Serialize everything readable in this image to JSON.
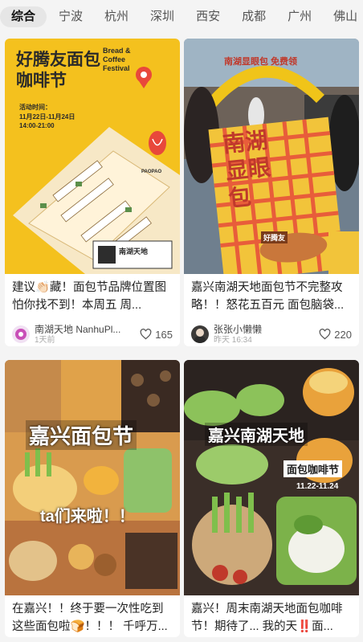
{
  "tabs": [
    "综合",
    "宁波",
    "杭州",
    "深圳",
    "西安",
    "成都",
    "广州",
    "佛山"
  ],
  "cards": [
    {
      "title": "建议👏🏻藏！面包节品牌位置图 怕你找不到！本周五 周...",
      "author": "南湖天地 NanhuPl...",
      "time": "1天前",
      "likes": "165",
      "image": {
        "heading": "好腾友面包咖啡节",
        "subheading": "Bread & Coffee Festival",
        "date_label": "活动时间：",
        "dates": "11月22日-11月24日",
        "hours": "14:00-21:00",
        "brand": "PAOPAO",
        "logo": "南湖天地"
      }
    },
    {
      "title": "嘉兴南湖天地面包节不完整攻略！！怒花五百元 面包脑袋...",
      "author": "张张小懒懒",
      "time": "昨天 16:34",
      "likes": "220",
      "image": {
        "banner": "南湖显眼包 免费领",
        "sign": "南湖显眼包",
        "tag": "好腾友"
      }
    },
    {
      "title": "在嘉兴！！终于要一次性吃到这些面包啦🍞！！！ 千呼万...",
      "image": {
        "headline": "嘉兴面包节",
        "subline": "ta们来啦！！"
      }
    },
    {
      "title": "嘉兴！周末南湖天地面包咖啡节！期待了... 我的天‼️面...",
      "image": {
        "headline": "嘉兴南湖天地",
        "subline": "面包咖啡节",
        "dates": "11.22-11.24"
      }
    }
  ],
  "colors": {
    "poster_yellow": "#f4c11e",
    "poster_red": "#e8483b",
    "heart": "#555555"
  }
}
